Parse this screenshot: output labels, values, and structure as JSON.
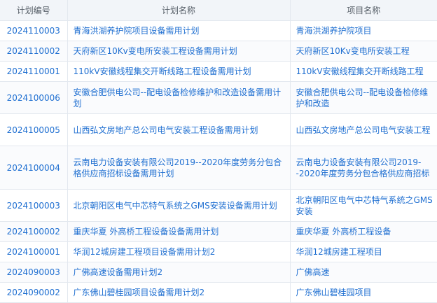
{
  "table": {
    "headers": [
      "计划编号",
      "计划名称",
      "项目名称"
    ],
    "rows": [
      {
        "id": "2024110003",
        "plan": "青海洪湖养护院项目设备需用计划",
        "project": "青海洪湖养护院项目"
      },
      {
        "id": "2024110002",
        "plan": "天府新区10Kv变电所安装工程设备需用计划",
        "project": "天府新区10Kv变电所安装工程"
      },
      {
        "id": "2024110001",
        "plan": "110kV安徽线程集交开断线路工程设备需用计划",
        "project": "110kV安徽线程集交开断线路工程"
      },
      {
        "id": "2024100006",
        "plan": "安徽合肥供电公司--配电设备检修维护和改造设备需用计划",
        "project": "安徽合肥供电公司--配电设备检修维护和改造"
      },
      {
        "id": "2024100005",
        "plan": "山西弘文房地产总公司电气安装工程设备需用计划",
        "project": "山西弘文房地产总公司电气安装工程"
      },
      {
        "id": "2024100004",
        "plan": "云南电力设备安装有限公司2019--2020年度劳务分包合格供应商招标设备需用计划",
        "project": "云南电力设备安装有限公司2019--2020年度劳务分包合格供应商招标"
      },
      {
        "id": "2024100003",
        "plan": "北京朝阳区电气中芯特气系统之GMS安装设备需用计划",
        "project": "北京朝阳区电气中芯特气系统之GMS安装"
      },
      {
        "id": "2024100002",
        "plan": "重庆华夏 外高桥工程设备设备需用计划",
        "project": "重庆华夏 外高桥工程设备"
      },
      {
        "id": "2024100001",
        "plan": "华润12城房建工程项目设备需用计划2",
        "project": "华润12城房建工程项目"
      },
      {
        "id": "2024090003",
        "plan": "广佛高速设备需用计划2",
        "project": "广佛高速"
      },
      {
        "id": "2024090002",
        "plan": "广东佛山碧桂园项目设备需用计划2",
        "project": "广东佛山碧桂园项目"
      }
    ]
  }
}
